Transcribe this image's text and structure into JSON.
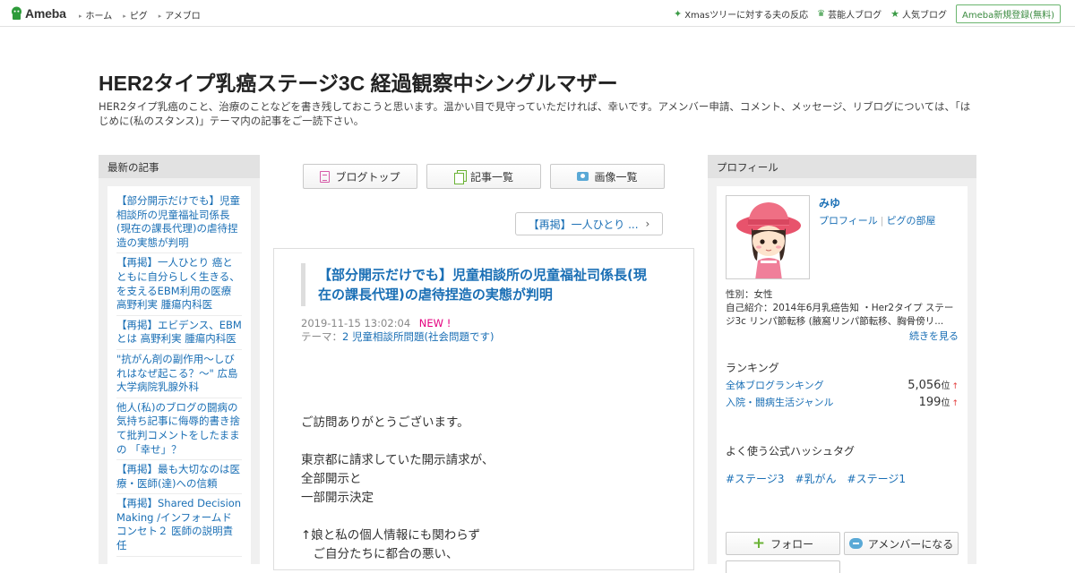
{
  "topbar": {
    "logo": "Ameba",
    "nav": [
      "ホーム",
      "ピグ",
      "アメブロ"
    ],
    "right": [
      {
        "icon": "star-icon",
        "label": "Xmasツリーに対する夫の反応"
      },
      {
        "icon": "crown-icon",
        "label": "芸能人ブログ"
      },
      {
        "icon": "star-icon",
        "label": "人気ブログ"
      }
    ],
    "register": "Ameba新規登録(無料)"
  },
  "header": {
    "title": "HER2タイプ乳癌ステージ3C 経過観察中シングルマザー",
    "description": "HER2タイプ乳癌のこと、治療のことなどを書き残しておこうと思います。温かい目で見守っていただければ、幸いです。アメンバー申請、コメント、メッセージ、リブログについては、「はじめに(私のスタンス)」テーマ内の記事をご一読下さい。"
  },
  "left_sidebar": {
    "heading": "最新の記事",
    "articles": [
      "【部分開示だけでも】児童相談所の児童福祉司係長(現在の課長代理)の虐待捏造の実態が判明",
      "【再掲】一人ひとり 癌とともに自分らしく生きる、を支えるEBM利用の医療 高野利実 腫瘍内科医",
      "【再掲】エビデンス、EBMとは 高野利実 腫瘍内科医",
      "\"抗がん剤の副作用～しびれはなぜ起こる？～\" 広島大学病院乳腺外科",
      "他人(私)のブログの闘病の気持ち記事に侮辱的書き捨て批判コメントをしたままの 「幸せ」？",
      "【再掲】最も大切なのは医療・医師(達)への信頼",
      "【再掲】Shared Decision Making /インフォームドコンセト２ 医師の説明責任"
    ]
  },
  "main": {
    "buttons": [
      {
        "icon": "blog-top-icon",
        "label": "ブログトップ"
      },
      {
        "icon": "article-list-icon",
        "label": "記事一覧"
      },
      {
        "icon": "camera-icon",
        "label": "画像一覧"
      }
    ],
    "prev_article": "【再掲】一人ひとり ...",
    "article": {
      "title": "【部分開示だけでも】児童相談所の児童福祉司係長(現在の課長代理)の虐待捏造の実態が判明",
      "date": "2019-11-15 13:02:04",
      "new_badge": "NEW !",
      "theme_label": "テーマ：",
      "theme": "2 児童相談所問題(社会問題です)",
      "body": [
        "ご訪問ありがとうございます。",
        "",
        "東京都に請求していた開示請求が、",
        "全部開示と",
        "一部開示決定",
        "",
        "↑娘と私の個人情報にも関わらず",
        "　ご自分たちに都合の悪い、"
      ]
    }
  },
  "right_sidebar": {
    "heading": "プロフィール",
    "name": "みゆ",
    "links": [
      "プロフィール",
      "ピグの部屋"
    ],
    "gender": "性別：女性",
    "intro": "自己紹介：2014年6月乳癌告知 ・Her2タイプ ステージ3c リンパ節転移 (腋窩リンパ節転移、胸骨傍リ...",
    "more": "続きを見る",
    "ranking_heading": "ランキング",
    "rankings": [
      {
        "label": "全体ブログランキング",
        "value": "5,056",
        "unit": "位",
        "trend": "↑"
      },
      {
        "label": "入院・闘病生活ジャンル",
        "value": "199",
        "unit": "位",
        "trend": "↑"
      }
    ],
    "hashtag_heading": "よく使う公式ハッシュタグ",
    "hashtags": [
      "#ステージ3",
      "#乳がん",
      "#ステージ1"
    ],
    "follow": "フォロー",
    "amember": "アメンバーになる"
  }
}
